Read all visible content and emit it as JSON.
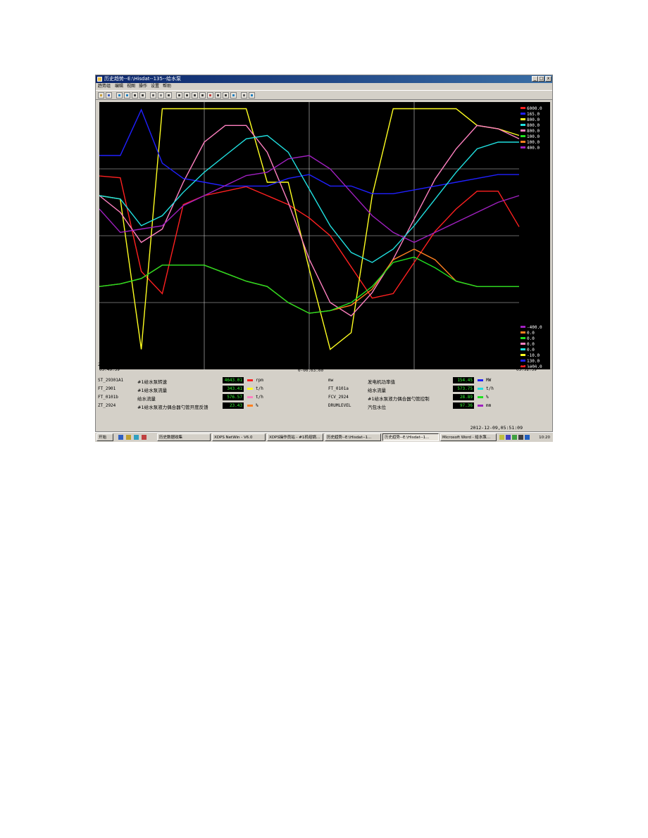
{
  "window": {
    "title": "历史趋势--E:\\Hisdat--135--给水泵",
    "btn_minimize": "_",
    "btn_maximize": "□",
    "btn_close": "x"
  },
  "menu": [
    "趋势组",
    "编辑",
    "视图",
    "操作",
    "设置",
    "帮助"
  ],
  "toolbar_icons": [
    "open-icon",
    "save-icon",
    "zoom-in-icon",
    "zoom-out-icon",
    "grid-icon",
    "list-icon",
    "table-icon",
    "scale-icon",
    "cursor-icon",
    "step-back-icon",
    "step-forward-icon",
    "page-icon",
    "page-back-icon",
    "mark-icon",
    "print-icon",
    "preview-icon",
    "refresh-icon",
    "settings-icon",
    "export-icon"
  ],
  "chart_data": {
    "type": "line",
    "right_axis_top_labels": [
      "6000.0",
      "165.0",
      "800.0",
      "800.0",
      "800.0",
      "100.0",
      "100.0",
      "400.0"
    ],
    "right_axis_bottom_labels": [
      "-400.0",
      "0.0",
      "0.0",
      "0.0",
      "0.0",
      "-10.0",
      "130.0",
      "3000.0"
    ],
    "top_label_colors": [
      "#ff2020",
      "#2020ff",
      "#ffff20",
      "#20e0e0",
      "#ff80c0",
      "#20e020",
      "#ff8020",
      "#a020c0"
    ],
    "bottom_label_colors": [
      "#a020c0",
      "#ff8020",
      "#20e020",
      "#ff80c0",
      "#20e0e0",
      "#ffff20",
      "#2020ff",
      "#ff2020"
    ],
    "x_start": [
      "2012-12-09",
      "05:49:39"
    ],
    "x_end": [
      "2012-12-09",
      "05:52:39"
    ],
    "x_center_label": [
      "天:时:分:秒",
      "0-00:03:00"
    ],
    "grid": true,
    "x": [
      0,
      5,
      10,
      15,
      20,
      25,
      30,
      35,
      40,
      45,
      50,
      55,
      60,
      65,
      70,
      75,
      80,
      85,
      90,
      95,
      100
    ],
    "series": [
      {
        "name": "#1给水泵转速",
        "unit": "rpm",
        "color": "#ff2020",
        "ymin": 3000,
        "ymax": 6000,
        "values": [
          5170,
          5150,
          4100,
          3850,
          4850,
          4950,
          5000,
          5050,
          4950,
          4850,
          4700,
          4500,
          4150,
          3800,
          3850,
          4200,
          4550,
          4800,
          5000,
          5000,
          4600
        ]
      },
      {
        "name": "#1给水泵流量",
        "unit": "t/h",
        "color": "#ffff20",
        "ymin": 0,
        "ymax": 800,
        "values": [
          520,
          510,
          60,
          780,
          780,
          780,
          780,
          780,
          560,
          560,
          300,
          60,
          110,
          520,
          780,
          780,
          780,
          780,
          730,
          720,
          700
        ]
      },
      {
        "name": "给水流量",
        "unit": "t/h",
        "color": "#ff80c0",
        "ymin": 0,
        "ymax": 800,
        "values": [
          520,
          470,
          380,
          420,
          560,
          680,
          730,
          730,
          650,
          500,
          330,
          200,
          160,
          230,
          330,
          450,
          570,
          660,
          730,
          720,
          690
        ]
      },
      {
        "name": "#1给水泵液力偶合器勺管开度反馈",
        "unit": "%",
        "color": "#ff8020",
        "ymin": 0,
        "ymax": 100,
        "values": [
          31,
          32,
          34,
          39,
          39,
          39,
          36,
          33,
          31,
          25,
          21,
          22,
          24,
          30,
          41,
          45,
          41,
          33,
          31,
          31,
          31
        ]
      },
      {
        "name": "发电机功率值",
        "unit": "MW",
        "color": "#2020ff",
        "ymin": 130,
        "ymax": 165,
        "values": [
          158,
          158,
          164,
          157,
          155,
          154.5,
          154,
          154,
          154,
          155,
          155.5,
          154,
          154,
          153,
          153,
          153.5,
          154,
          154.5,
          155,
          155.5,
          155.5
        ]
      },
      {
        "name": "给水流量",
        "unit": "t/h",
        "color": "#20e0e0",
        "ymin": 0,
        "ymax": 800,
        "values": [
          520,
          510,
          430,
          460,
          530,
          590,
          640,
          690,
          700,
          650,
          540,
          430,
          350,
          320,
          360,
          430,
          510,
          590,
          660,
          680,
          680
        ]
      },
      {
        "name": "#1给水泵液力偶合器勺管控制",
        "unit": "%",
        "color": "#20e020",
        "ymin": 0,
        "ymax": 100,
        "values": [
          31,
          32,
          34,
          39,
          39,
          39,
          36,
          33,
          31,
          25,
          21,
          22,
          25,
          31,
          40,
          42,
          38,
          33,
          31,
          31,
          31
        ]
      },
      {
        "name": "汽包水位",
        "unit": "mm",
        "color": "#a020c0",
        "ymin": -400,
        "ymax": 400,
        "values": [
          80,
          10,
          20,
          30,
          90,
          120,
          150,
          180,
          190,
          230,
          240,
          200,
          130,
          60,
          10,
          -20,
          10,
          40,
          70,
          100,
          120
        ]
      }
    ]
  },
  "info": {
    "left": [
      {
        "tag": "ST_29301A1",
        "desc": "#1给水泵转速",
        "value": "4643.01",
        "unit": "rpm",
        "color": "#ff2020"
      },
      {
        "tag": "FT_2901",
        "desc": "#1给水泵流量",
        "value": "343.41",
        "unit": "t/h",
        "color": "#ffff20"
      },
      {
        "tag": "FT_0101b",
        "desc": "给水流量",
        "value": "576.57",
        "unit": "t/h",
        "color": "#ff80c0"
      },
      {
        "tag": "ZT_2924",
        "desc": "#1给水泵液力偶合器勺管开度反馈",
        "value": "23.43",
        "unit": "%",
        "color": "#ff8020"
      }
    ],
    "right": [
      {
        "tag": "mw",
        "desc": "发电机功率值",
        "value": "154.45",
        "unit": "MW",
        "color": "#2020ff"
      },
      {
        "tag": "FT_0101a",
        "desc": "给水流量",
        "value": "573.75",
        "unit": "t/h",
        "color": "#20e0e0"
      },
      {
        "tag": "FCV_2924",
        "desc": "#1给水泵液力偶合器勺管控制",
        "value": "28.89",
        "unit": "%",
        "color": "#20e020"
      },
      {
        "tag": "DRUMLEVEL",
        "desc": "汽包水位",
        "value": "97.36",
        "unit": "mm",
        "color": "#a020c0"
      }
    ]
  },
  "status_time": "2012-12-09,05:51:09",
  "taskbar": {
    "start": "开始",
    "buttons": [
      "历史数据收集",
      "XDPS NetWin - V6.0",
      "XDPS操作员站 - #1机组锅...",
      "历史趋势--E:\\Hisdat--1...",
      "历史趋势--E:\\Hisdat--1...",
      "Microsoft Word - 给水泵..."
    ],
    "clock": "10:20"
  }
}
